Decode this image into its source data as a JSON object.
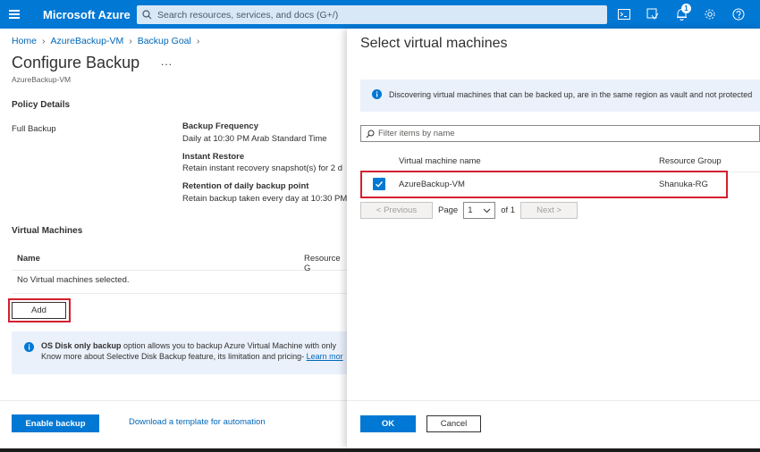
{
  "topbar": {
    "brand": "Microsoft Azure",
    "search_placeholder": "Search resources, services, and docs (G+/)",
    "notification_count": "1",
    "accent_color": "#0078d4"
  },
  "breadcrumb": {
    "home": "Home",
    "vault": "AzureBackup-VM",
    "goal": "Backup Goal"
  },
  "page": {
    "title": "Configure Backup",
    "more": "...",
    "subtitle": "AzureBackup-VM"
  },
  "policy": {
    "heading": "Policy Details",
    "name": "Full Backup",
    "frequency_label": "Backup Frequency",
    "frequency_value": "Daily at 10:30 PM Arab Standard Time",
    "instant_label": "Instant Restore",
    "instant_value": "Retain instant recovery snapshot(s) for 2 d",
    "retention_label": "Retention of daily backup point",
    "retention_value": "Retain backup taken every day at 10:30 PM"
  },
  "vms": {
    "heading": "Virtual Machines",
    "col_name": "Name",
    "col_rg": "Resource G",
    "empty": "No Virtual machines selected.",
    "add_label": "Add"
  },
  "os_info": {
    "bold": "OS Disk only backup",
    "text": " option allows you to backup Azure Virtual Machine with only",
    "line2": "Know more about Selective Disk Backup feature, its limitation and pricing- ",
    "link": "Learn mor"
  },
  "footer_left": {
    "enable_label": "Enable backup",
    "download_label": "Download a template for automation"
  },
  "panel": {
    "title": "Select virtual machines",
    "info": "Discovering virtual machines that can be backed up, are in the same region as vault and not protected",
    "filter_placeholder": "Filter items by name",
    "col_vm": "Virtual machine name",
    "col_rg": "Resource Group",
    "rows": [
      {
        "name": "AzureBackup-VM",
        "rg": "Shanuka-RG",
        "checked": true
      }
    ],
    "pager": {
      "prev": "< Previous",
      "page_label": "Page",
      "page_value": "1",
      "of_label": "of 1",
      "next": "Next >"
    },
    "ok_label": "OK",
    "cancel_label": "Cancel"
  }
}
